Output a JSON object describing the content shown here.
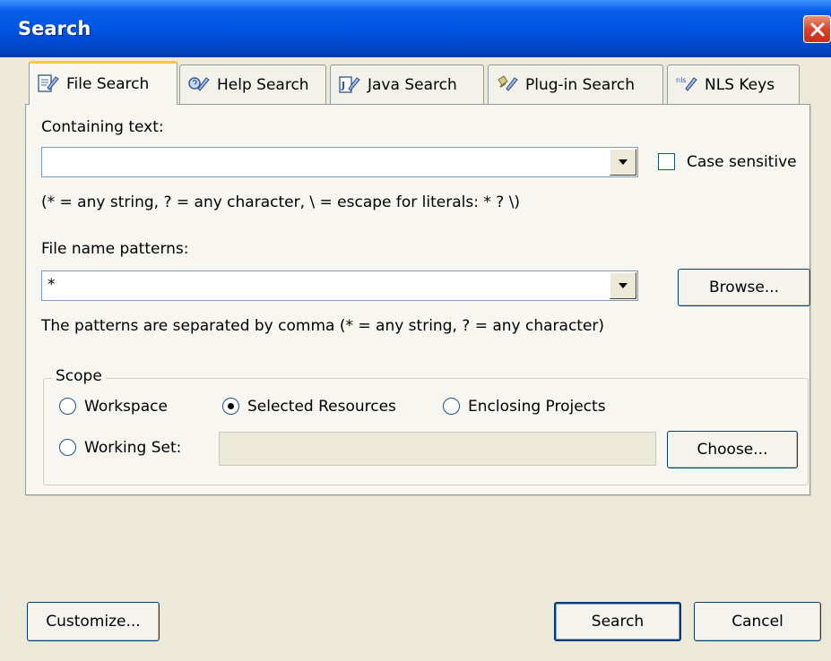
{
  "window": {
    "title": "Search"
  },
  "tabs": [
    {
      "label": "File Search",
      "icon": "file-search-icon",
      "active": true
    },
    {
      "label": "Help Search",
      "icon": "help-search-icon",
      "active": false
    },
    {
      "label": "Java Search",
      "icon": "java-search-icon",
      "active": false
    },
    {
      "label": "Plug-in Search",
      "icon": "plugin-search-icon",
      "active": false
    },
    {
      "label": "NLS Keys",
      "icon": "nls-keys-icon",
      "active": false
    }
  ],
  "containing_text": {
    "label": "Containing text:",
    "value": "",
    "hint": "(* = any string, ? = any character, \\ = escape for literals: * ? \\)",
    "case_sensitive_label": "Case sensitive",
    "case_sensitive_checked": false
  },
  "file_name_patterns": {
    "label": "File name patterns:",
    "value": "*",
    "browse_label": "Browse...",
    "hint": "The patterns are separated by comma (* = any string, ? = any character)"
  },
  "scope": {
    "title": "Scope",
    "options": [
      {
        "label": "Workspace",
        "selected": false
      },
      {
        "label": "Selected Resources",
        "selected": true
      },
      {
        "label": "Enclosing Projects",
        "selected": false
      },
      {
        "label": "Working Set:",
        "selected": false
      }
    ],
    "working_set_value": "",
    "choose_label": "Choose..."
  },
  "footer": {
    "customize_label": "Customize...",
    "search_label": "Search",
    "cancel_label": "Cancel"
  },
  "colors": {
    "titlebar": "#0054e3",
    "dialog_bg": "#ece9d8",
    "close_button": "#d9432b",
    "active_tab_accent": "#ffc83c"
  }
}
